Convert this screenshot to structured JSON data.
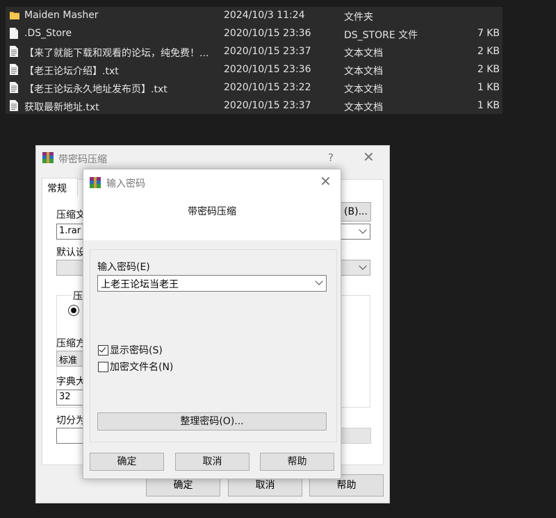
{
  "files": [
    {
      "name": "Maiden Masher",
      "date": "2024/10/3 11:24",
      "type": "文件夹",
      "size": "",
      "icon": "folder-icon"
    },
    {
      "name": ".DS_Store",
      "date": "2020/10/15 23:36",
      "type": "DS_STORE 文件",
      "size": "7 KB",
      "icon": "file-icon"
    },
    {
      "name": "【来了就能下载和观看的论坛，纯免费！...",
      "date": "2020/10/15 23:37",
      "type": "文本文档",
      "size": "2 KB",
      "icon": "text-file-icon"
    },
    {
      "name": "【老王论坛介绍】.txt",
      "date": "2020/10/15 23:36",
      "type": "文本文档",
      "size": "2 KB",
      "icon": "text-file-icon"
    },
    {
      "name": "【老王论坛永久地址发布页】.txt",
      "date": "2020/10/15 23:22",
      "type": "文本文档",
      "size": "1 KB",
      "icon": "text-file-icon"
    },
    {
      "name": "获取最新地址.txt",
      "date": "2020/10/15 23:37",
      "type": "文本文档",
      "size": "1 KB",
      "icon": "text-file-icon"
    }
  ],
  "back_dialog": {
    "title": "带密码压缩",
    "help": "?",
    "tab": "常规",
    "archive_label": "压缩文",
    "browse_button": "(B)...",
    "archive_value": "1.rar",
    "default_label": "默认设",
    "format_label": "压缩",
    "method_label": "压缩方",
    "method_value": "标准",
    "dict_label": "字典大",
    "dict_value": "32",
    "split_label": "切分为",
    "paren": ")",
    "ok": "确定",
    "cancel": "取消",
    "help_button": "帮助"
  },
  "front_dialog": {
    "title": "输入密码",
    "header": "带密码压缩",
    "password_label": "输入密码(E)",
    "password_value": "上老王论坛当老王",
    "show_password": "显示密码(S)",
    "show_password_checked": true,
    "encrypt_names": "加密文件名(N)",
    "encrypt_names_checked": false,
    "organize_button": "整理密码(O)...",
    "ok": "确定",
    "cancel": "取消",
    "help": "帮助"
  }
}
